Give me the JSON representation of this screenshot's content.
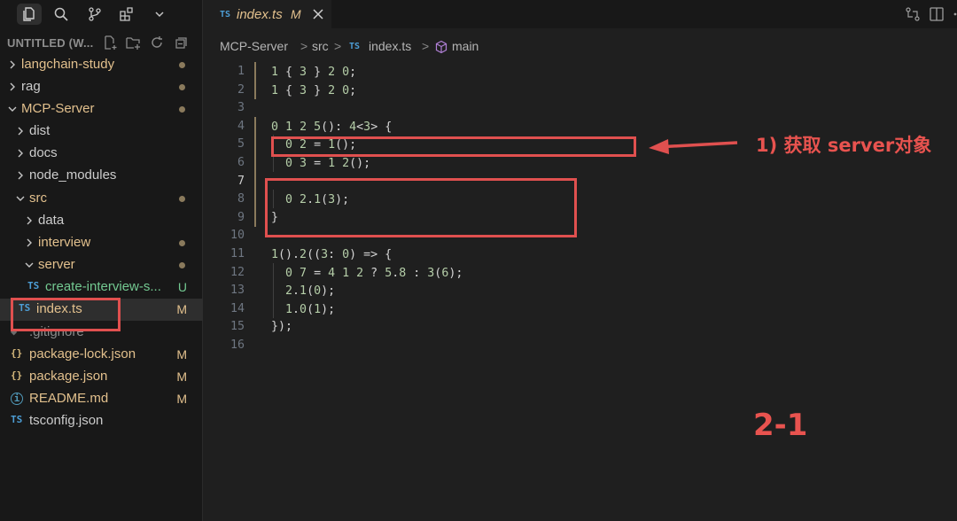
{
  "window": {
    "workspace_title": "UNTITLED (W...",
    "tab": {
      "badge": "TS",
      "name": "index.ts",
      "modified": "M"
    }
  },
  "breadcrumb": {
    "items": [
      "MCP-Server",
      "src",
      "index.ts",
      "main"
    ],
    "separator": ">",
    "file_badge": "TS"
  },
  "explorer": {
    "items": [
      {
        "label": "langchain-study",
        "status": "dot"
      },
      {
        "label": "rag",
        "status": "dot"
      },
      {
        "label": "MCP-Server",
        "status": "dot"
      },
      {
        "label": "dist"
      },
      {
        "label": "docs"
      },
      {
        "label": "node_modules"
      },
      {
        "label": "src",
        "status": "dot"
      },
      {
        "label": "data"
      },
      {
        "label": "interview",
        "status": "dot"
      },
      {
        "label": "server",
        "status": "dot"
      },
      {
        "label": "create-interview-s...",
        "badge": "TS",
        "status": "U"
      },
      {
        "label": "index.ts",
        "badge": "TS",
        "status": "M"
      },
      {
        "label": ".gitignore"
      },
      {
        "label": "package-lock.json",
        "badge": "{}",
        "status": "M"
      },
      {
        "label": "package.json",
        "badge": "{}",
        "status": "M"
      },
      {
        "label": "README.md",
        "badge": "i",
        "status": "M"
      },
      {
        "label": "tsconfig.json",
        "badge": "TS"
      }
    ]
  },
  "code": {
    "current_line": 7,
    "lines": [
      {
        "n": "1",
        "text": "import { StdioServerTransport } from \"@modelcontextprotocol/sdk/server/stdio.js\";"
      },
      {
        "n": "2",
        "text": "import { createInterviewMcpServer } from \"./server/create-interview-server.js\";"
      },
      {
        "n": "3",
        "text": ""
      },
      {
        "n": "4",
        "text": "export async function main(): Promise<void> {"
      },
      {
        "n": "5",
        "text": "  const server = createInterviewMcpServer();"
      },
      {
        "n": "6",
        "text": "  const transport = new StdioServerTransport();"
      },
      {
        "n": "7",
        "text": ""
      },
      {
        "n": "8",
        "text": "  await server.connect(transport);"
      },
      {
        "n": "9",
        "text": "}"
      },
      {
        "n": "10",
        "text": ""
      },
      {
        "n": "11",
        "text": "main().catch((error: unknown) => {"
      },
      {
        "n": "12",
        "text": "  const message = error instanceof Error ? error.message : String(error);"
      },
      {
        "n": "13",
        "text": "  console.error(`[ai-agent-interview-mcp] ${message}`);"
      },
      {
        "n": "14",
        "text": "  process.exit(1);"
      },
      {
        "n": "15",
        "text": "});"
      },
      {
        "n": "16",
        "text": ""
      }
    ]
  },
  "annotations": {
    "callout": "1) 获取 server对象",
    "figure_label": "2-1"
  },
  "colors": {
    "accent_red": "#e0504f",
    "modified": "#e2c08d",
    "untracked": "#73c991",
    "ts_badge": "#4d9ed6"
  },
  "icons": [
    "files-icon",
    "search-icon",
    "source-control-icon",
    "extensions-icon",
    "chevron-down-icon",
    "new-file-icon",
    "new-folder-icon",
    "refresh-icon",
    "collapse-all-icon",
    "compare-icon",
    "split-editor-icon",
    "more-actions-icon",
    "close-icon",
    "symbol-method-icon"
  ]
}
